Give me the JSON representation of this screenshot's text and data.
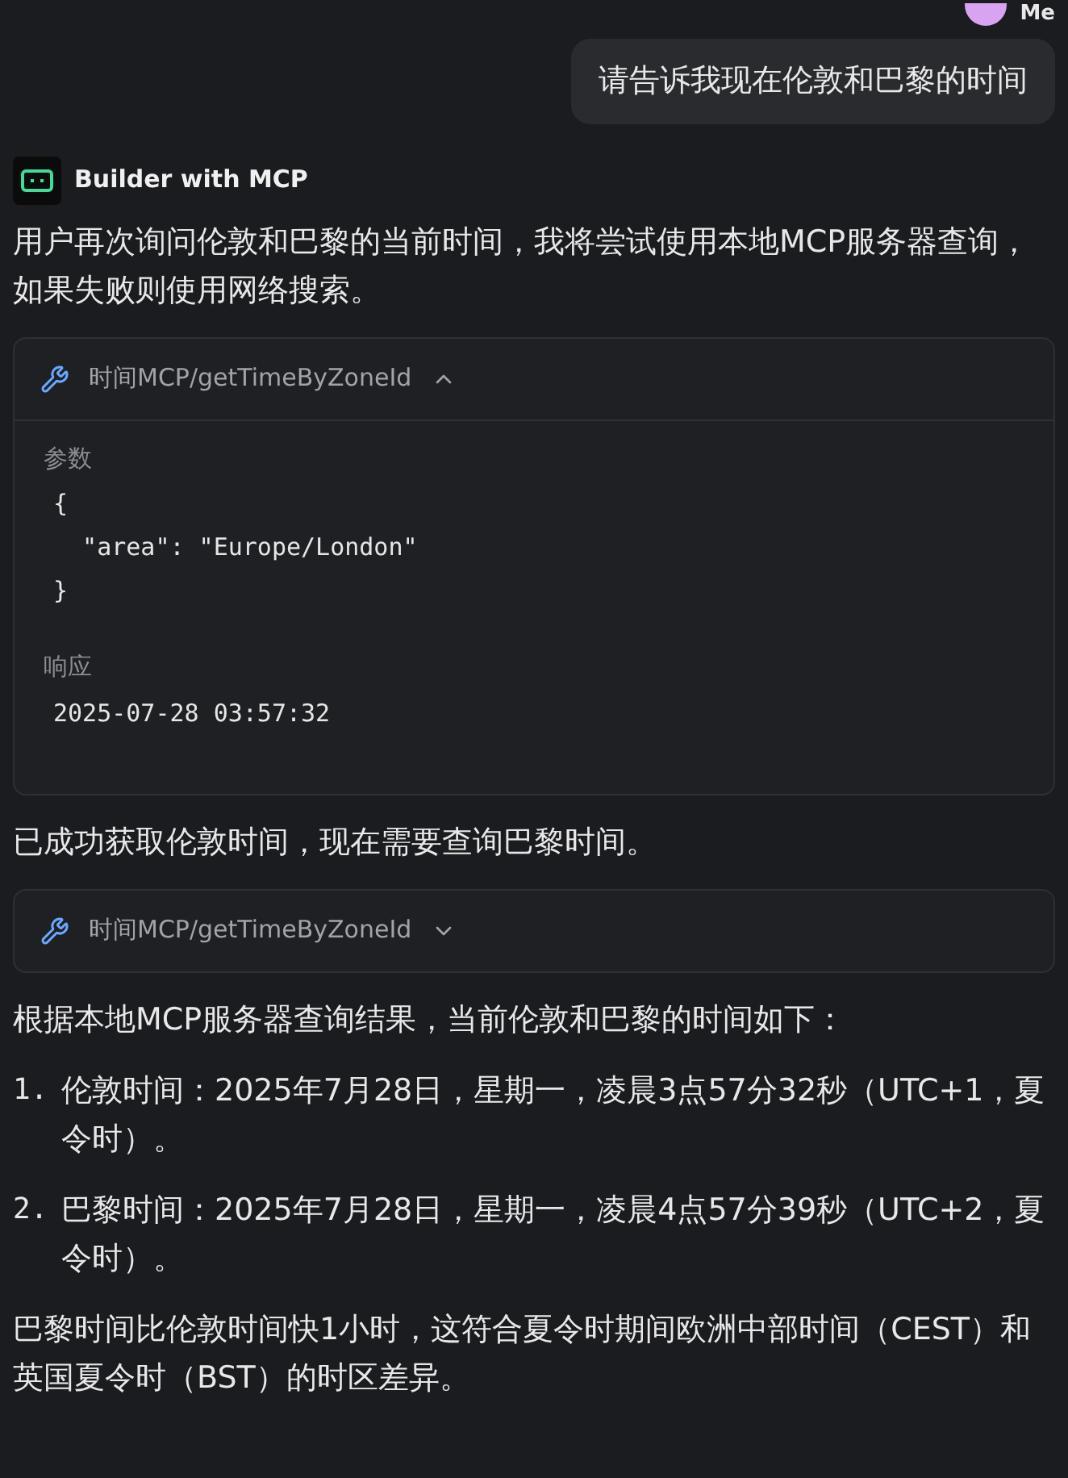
{
  "user": {
    "name": "Me",
    "message": "请告诉我现在伦敦和巴黎的时间"
  },
  "assistant": {
    "name": "Builder with MCP"
  },
  "blocks": [
    {
      "kind": "text",
      "text": "用户再次询问伦敦和巴黎的当前时间，我将尝试使用本地MCP服务器查询，如果失败则使用网络搜索。"
    },
    {
      "kind": "tool",
      "title": "时间MCP/getTimeByZoneId",
      "expanded": true,
      "params_label": "参数",
      "params": [
        "{",
        "  \"area\": \"Europe/London\"",
        "}"
      ],
      "response_label": "响应",
      "response": "2025-07-28 03:57:32"
    },
    {
      "kind": "text",
      "text": "已成功获取伦敦时间，现在需要查询巴黎时间。"
    },
    {
      "kind": "tool",
      "title": "时间MCP/getTimeByZoneId",
      "expanded": false
    },
    {
      "kind": "text",
      "text": "根据本地MCP服务器查询结果，当前伦敦和巴黎的时间如下："
    },
    {
      "kind": "list",
      "items": [
        {
          "number": "1.",
          "text": "伦敦时间：2025年7月28日，星期一，凌晨3点57分32秒（UTC+1，夏令时）。"
        },
        {
          "number": "2.",
          "text": "巴黎时间：2025年7月28日，星期一，凌晨4点57分39秒（UTC+2，夏令时）。"
        }
      ]
    },
    {
      "kind": "text",
      "text": "巴黎时间比伦敦时间快1小时，这符合夏令时期间欧洲中部时间（CEST）和英国夏令时（BST）的时区差异。"
    }
  ]
}
